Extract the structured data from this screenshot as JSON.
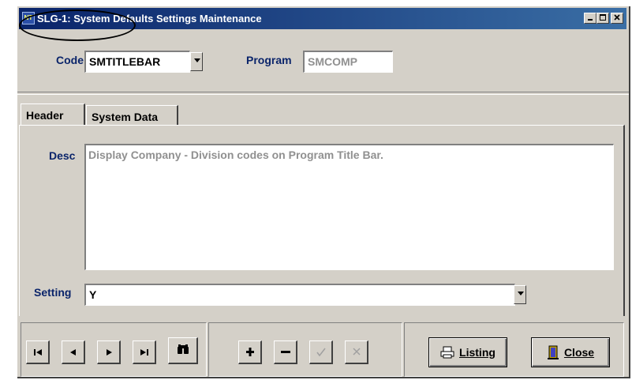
{
  "window": {
    "title": "SLG-1: System Defaults Settings Maintenance",
    "app_icon": "app-logo-icon",
    "controls": [
      "minimize-icon",
      "maximize-icon",
      "close-icon"
    ]
  },
  "code": {
    "label": "Code",
    "value": "SMTITLEBAR"
  },
  "program": {
    "label": "Program",
    "value": "SMCOMP"
  },
  "tabs": [
    {
      "label": "Header",
      "active": true
    },
    {
      "label": "System Data",
      "active": false
    }
  ],
  "desc": {
    "label": "Desc",
    "value": "Display Company - Division codes on Program Title Bar."
  },
  "setting": {
    "label": "Setting",
    "value": "Y"
  },
  "navigation": {
    "first": "⏮",
    "previous": "◀",
    "next": "▶",
    "last": "⏭",
    "find": "binoculars-icon"
  },
  "record": {
    "add": "+",
    "delete": "−",
    "save": "✓",
    "cancel": "✕"
  },
  "buttons": {
    "listing": "Listing",
    "listing_icon": "printer-icon",
    "close": "Close",
    "close_icon": "door-exit-icon"
  },
  "colors": {
    "label_blue": "#0a246a",
    "titlebar_start": "#0a246a",
    "titlebar_end": "#3a6ea5",
    "face": "#d4d0c8"
  }
}
